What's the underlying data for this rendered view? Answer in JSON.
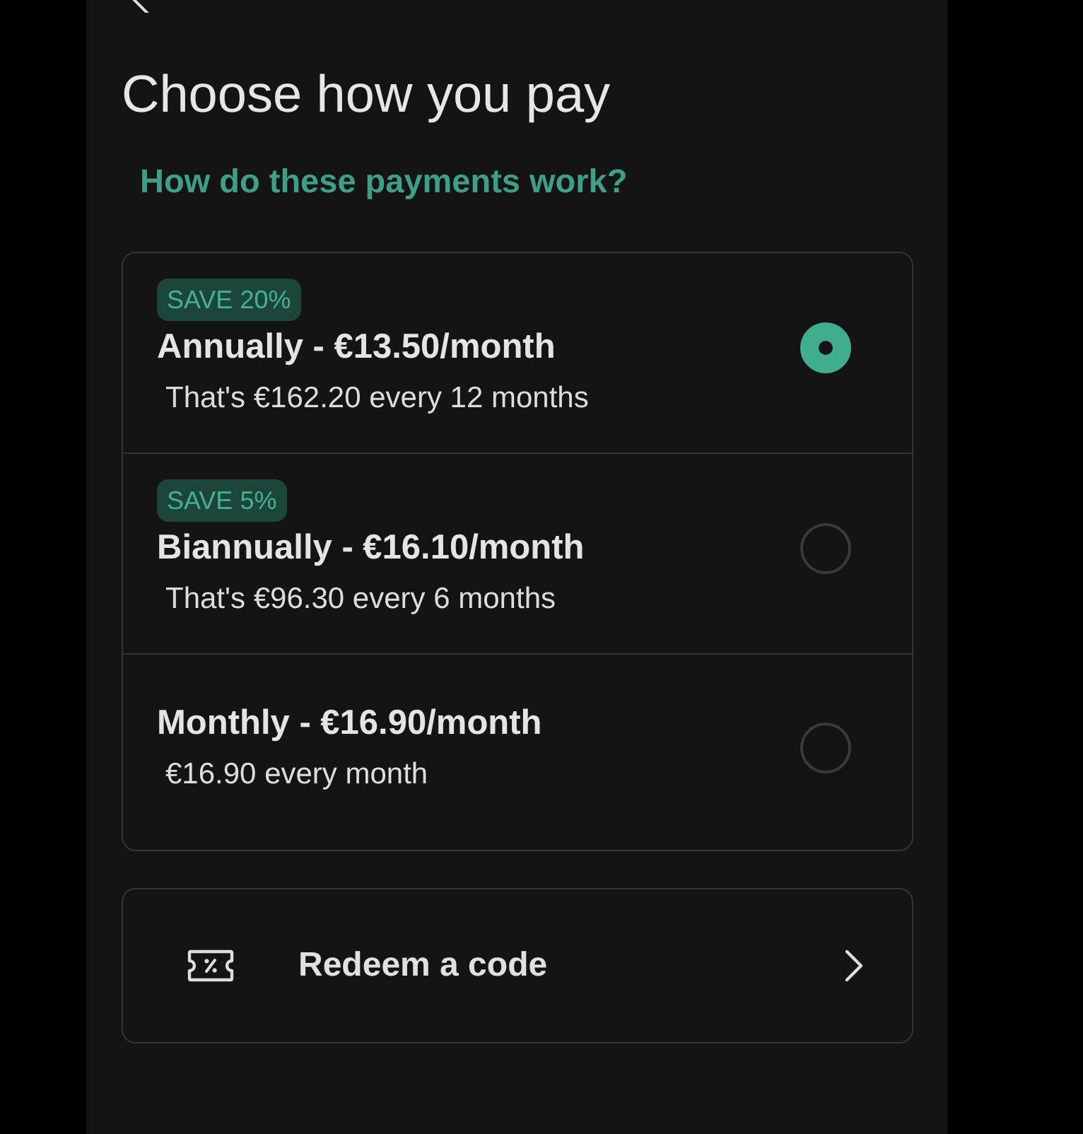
{
  "header": {
    "title": "Choose how you pay",
    "help_link": "How do these payments work?"
  },
  "plans": [
    {
      "badge": "SAVE 20%",
      "title": "Annually - €13.50/month",
      "detail": "That's €162.20 every 12 months",
      "selected": true
    },
    {
      "badge": "SAVE 5%",
      "title": "Biannually - €16.10/month",
      "detail": "That's €96.30 every 6 months",
      "selected": false
    },
    {
      "title": "Monthly - €16.90/month",
      "detail": "€16.90 every month",
      "selected": false
    }
  ],
  "redeem": {
    "label": "Redeem a code"
  }
}
